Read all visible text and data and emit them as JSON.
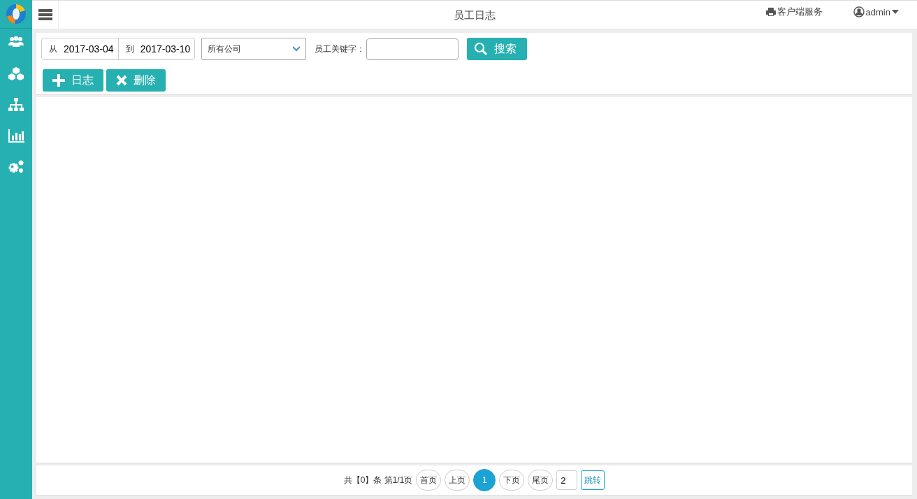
{
  "header": {
    "title": "员工日志",
    "service_link": "客户端服务",
    "user": "admin"
  },
  "filters": {
    "from_label": "从",
    "from_date": "2017-03-04",
    "to_label": "到",
    "to_date": "2017-03-10",
    "company": "所有公司",
    "keyword_label": "员工关键字：",
    "search_button": "搜索"
  },
  "actions": [
    {
      "kind": "add",
      "label": "日志"
    },
    {
      "kind": "delete",
      "label": "删除"
    }
  ],
  "pagination": {
    "summary": "共【0】条 第1/1页",
    "pages": [
      {
        "label": "首页",
        "selected": false
      },
      {
        "label": "上页",
        "selected": false
      },
      {
        "label": "1",
        "selected": true
      },
      {
        "label": "下页",
        "selected": false
      },
      {
        "label": "尾页",
        "selected": false
      }
    ],
    "jump_value": "2",
    "jump_button": "跳转"
  }
}
